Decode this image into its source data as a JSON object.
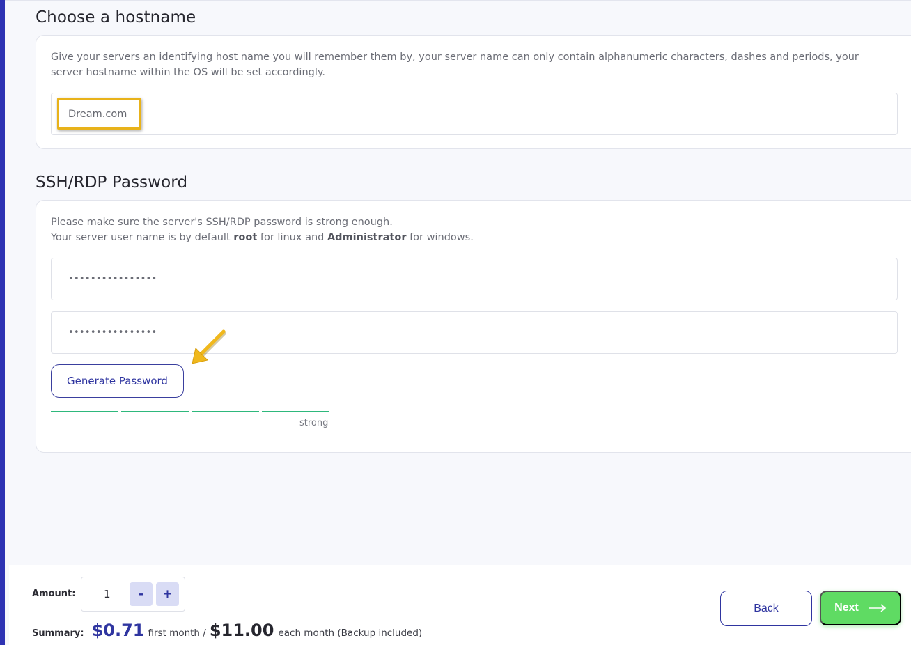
{
  "hostname_section": {
    "title": "Choose a hostname",
    "description": "Give your servers an identifying host name you will remember them by, your server name can only contain alphanumeric characters, dashes and periods, your server hostname within the OS will be set accordingly.",
    "hostname_value": "Dream.com"
  },
  "password_section": {
    "title": "SSH/RDP Password",
    "desc_line1": "Please make sure the server's SSH/RDP password is strong enough.",
    "desc_line2_prefix": "Your server user name is by default ",
    "desc_root": "root",
    "desc_mid": " for linux and ",
    "desc_admin": "Administrator",
    "desc_suffix": " for windows.",
    "password_mask": "••••••••••••••••",
    "confirm_mask": "••••••••••••••••",
    "generate_label": "Generate Password",
    "strength_label": "strong",
    "strength_segments": 4
  },
  "footer": {
    "amount_label": "Amount:",
    "quantity": "1",
    "minus_label": "-",
    "plus_label": "+",
    "summary_label": "Summary:",
    "first_price": "$0.71",
    "first_text": "first month /",
    "monthly_price": "$11.00",
    "monthly_text": "each month (Backup included)",
    "back_label": "Back",
    "next_label": "Next"
  },
  "icons": {
    "next_arrow": "arrow-right-icon",
    "annotation": "yellow-pointer-arrow"
  },
  "colors": {
    "primary": "#2f35a0",
    "success": "#5fdb63",
    "highlight": "#e8b21a",
    "strength": "#2eb87c"
  }
}
